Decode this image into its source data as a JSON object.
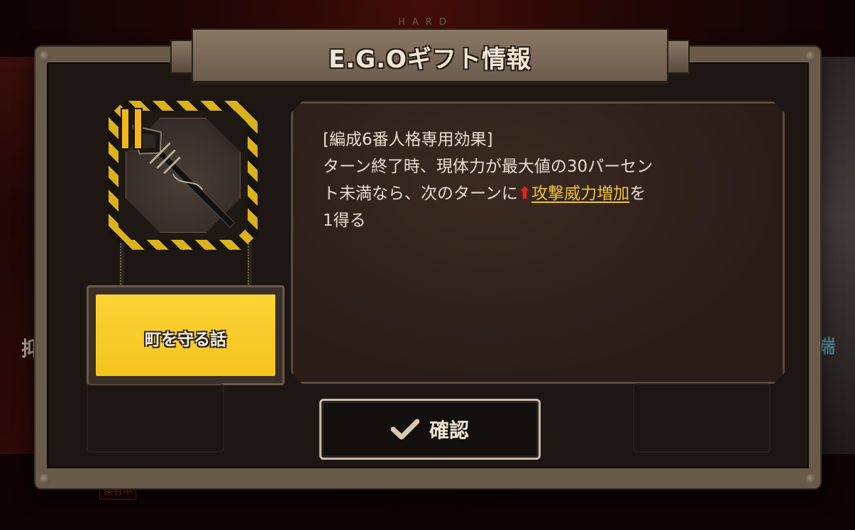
{
  "background": {
    "difficulty": "HARD",
    "left_char": "抑",
    "right_char": "端",
    "owned_label": "保有中"
  },
  "dialog": {
    "title": "E.G.Oギフト情報",
    "gift": {
      "tier": "II",
      "icon": "spear-icon",
      "name": "町を守る話"
    },
    "description": {
      "line1": "[編成6番人格専用効果]",
      "line2": "ターン終了時、現体力が最大値の30パーセン",
      "line3_prefix": "ト未満なら、次のターンに",
      "buff_icon": "red-up-arrow-icon",
      "buff_name": "攻撃威力増加",
      "line3_suffix": "を",
      "line4": "1得る"
    },
    "confirm_label": "確認"
  },
  "colors": {
    "accent_yellow": "#f4c41e",
    "buff_link": "#f0c23a",
    "up_arrow": "#e2261a"
  }
}
